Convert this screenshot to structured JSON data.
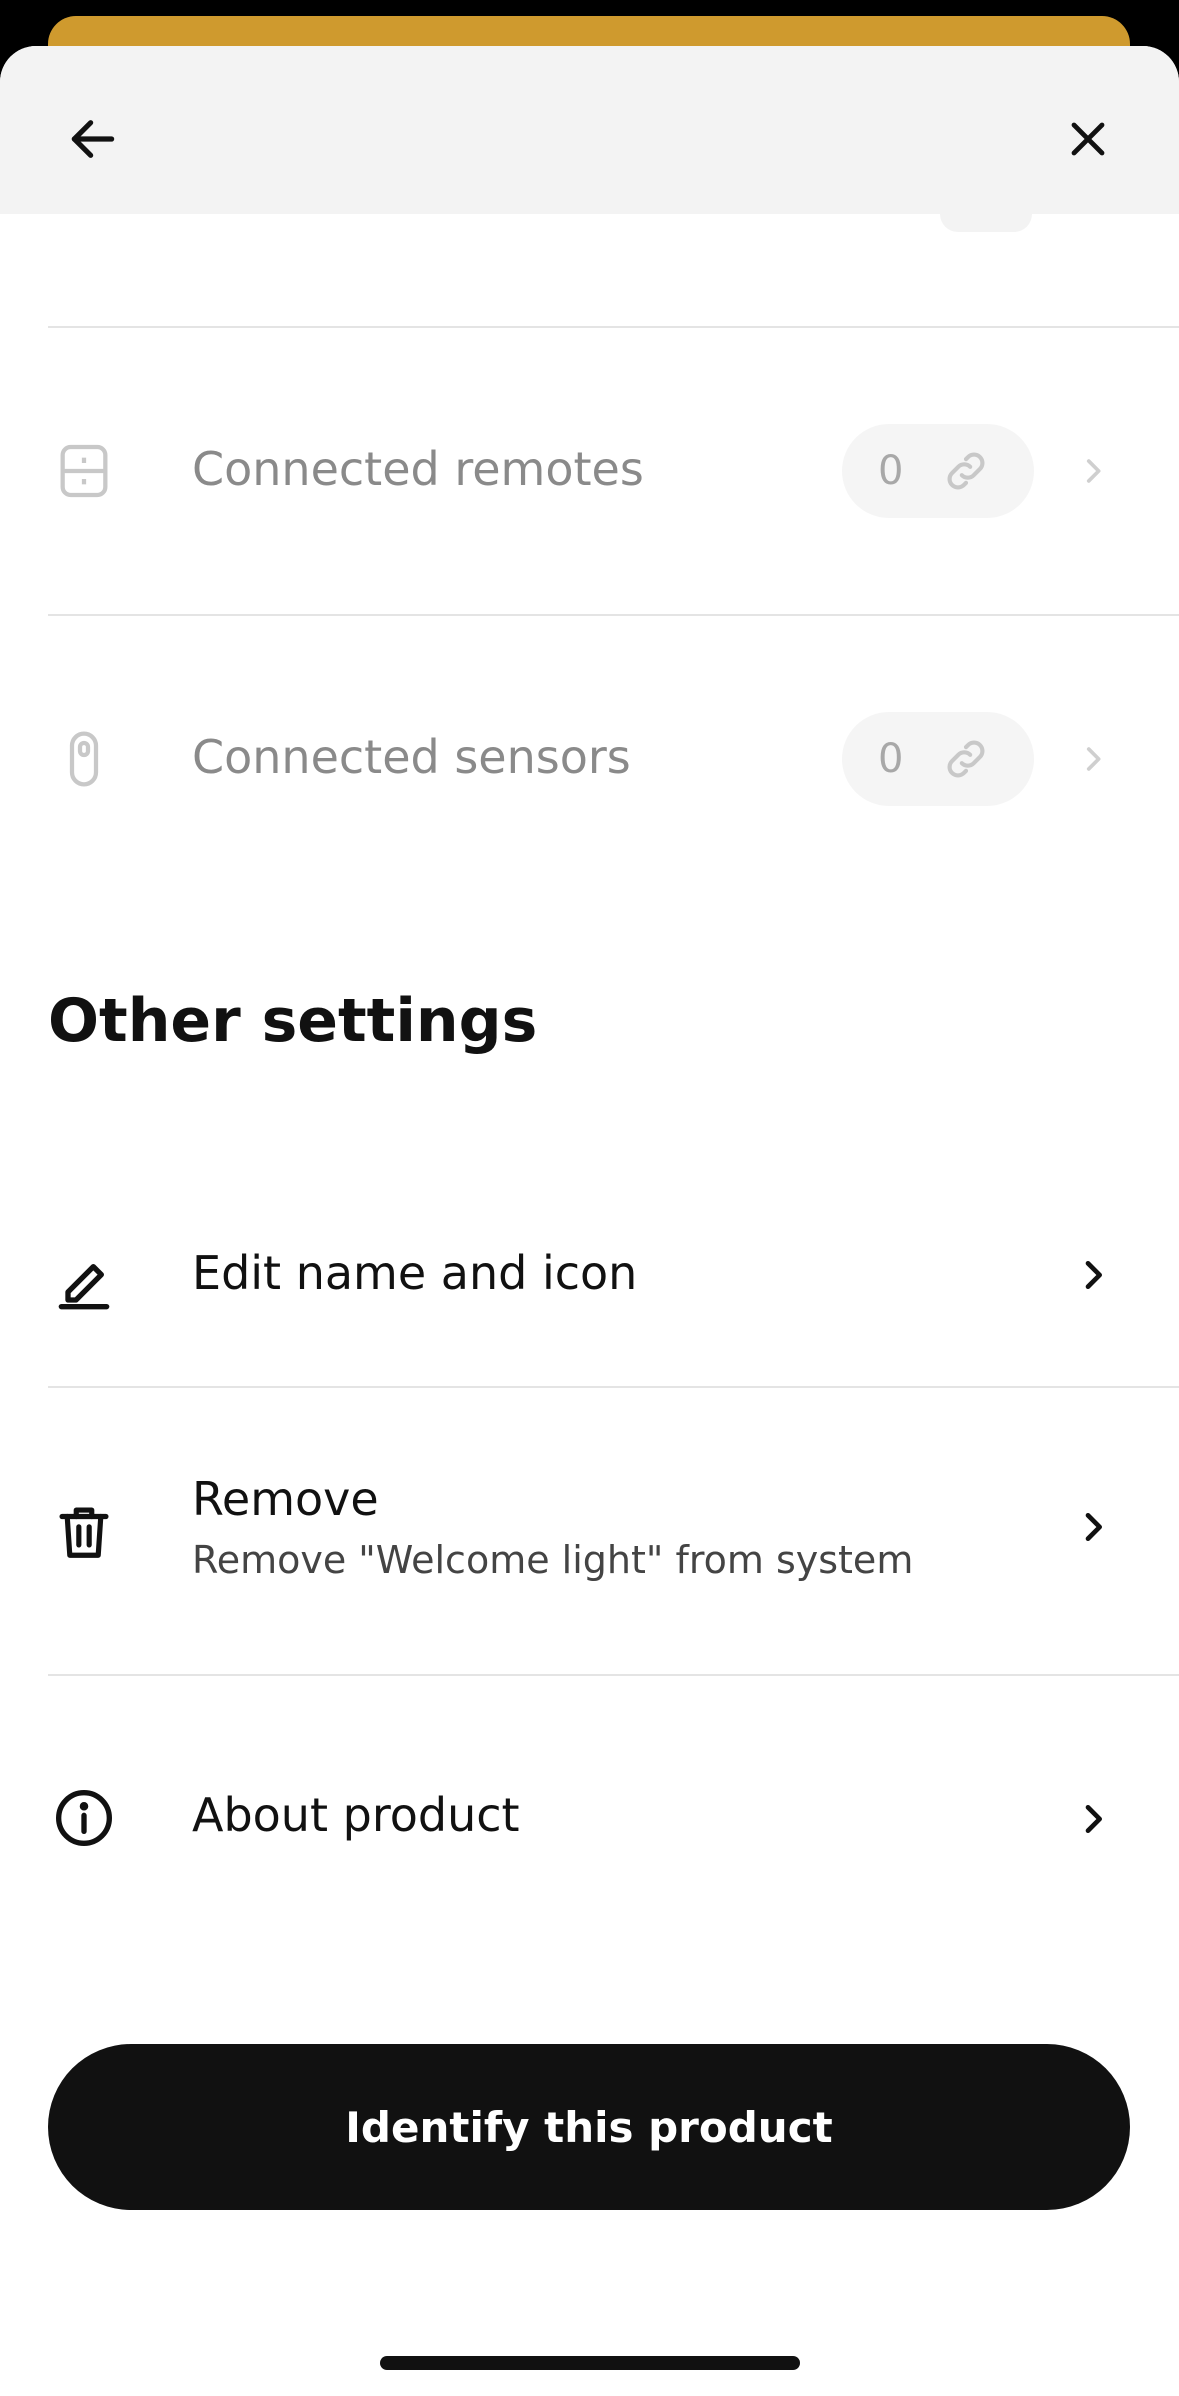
{
  "colors": {
    "accent": "#cf9a2e",
    "primary": "#111111",
    "muted": "#8a8a8a"
  },
  "icons": {
    "back": "arrow-left-icon",
    "close": "close-icon",
    "remotes": "remote-icon",
    "sensors": "sensor-icon",
    "edit": "pencil-icon",
    "remove": "trash-icon",
    "about": "info-icon",
    "link": "link-icon",
    "chevron": "chevron-right-icon"
  },
  "connected": {
    "remotes": {
      "label": "Connected remotes",
      "count": "0"
    },
    "sensors": {
      "label": "Connected sensors",
      "count": "0"
    }
  },
  "other_settings": {
    "title": "Other settings",
    "items": [
      {
        "label": "Edit name and icon"
      },
      {
        "label": "Remove",
        "sub": "Remove \"Welcome light\" from system"
      },
      {
        "label": "About product"
      }
    ]
  },
  "primary_button": {
    "label": "Identify this product"
  }
}
